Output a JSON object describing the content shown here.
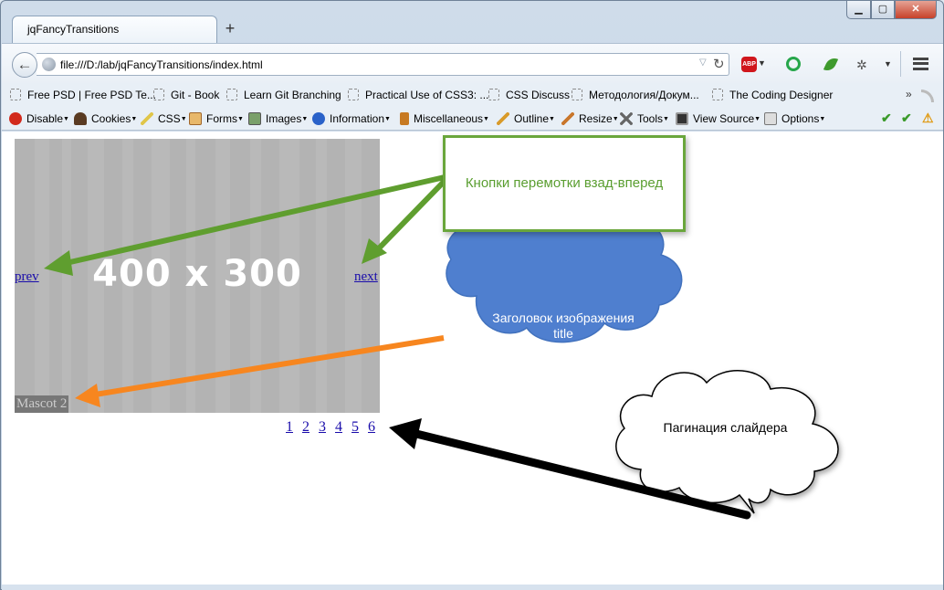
{
  "window": {
    "tab_title": "jqFancyTransitions",
    "new_tab": "+",
    "minimize": "▁",
    "maximize": "▢",
    "close": "✕"
  },
  "navbar": {
    "back": "←",
    "url": "file:///D:/lab/jqFancyTransitions/index.html",
    "abp_label": "ABP"
  },
  "bookmarks": [
    "Free PSD | Free PSD Te...",
    "Git - Book",
    "Learn Git Branching",
    "Practical Use of CSS3: ...",
    "CSS Discuss",
    "Методология/Докум...",
    "The Coding Designer"
  ],
  "bookmarks_more": "»",
  "devbar": [
    {
      "label": "Disable",
      "icon": "disable-icon",
      "color": "#d22a1c"
    },
    {
      "label": "Cookies",
      "icon": "cookies-icon",
      "color": "#5a3b22"
    },
    {
      "label": "CSS",
      "icon": "css-icon",
      "color": "#8a6b1e"
    },
    {
      "label": "Forms",
      "icon": "forms-icon",
      "color": "#b9782a"
    },
    {
      "label": "Images",
      "icon": "images-icon",
      "color": "#6b8f5a"
    },
    {
      "label": "Information",
      "icon": "information-icon",
      "color": "#2a62c9"
    },
    {
      "label": "Miscellaneous",
      "icon": "miscellaneous-icon",
      "color": "#c77a22"
    },
    {
      "label": "Outline",
      "icon": "outline-icon",
      "color": "#d99b2b"
    },
    {
      "label": "Resize",
      "icon": "resize-icon",
      "color": "#c9772c"
    },
    {
      "label": "Tools",
      "icon": "tools-icon",
      "color": "#666666"
    },
    {
      "label": "View Source",
      "icon": "view-source-icon",
      "color": "#333333"
    },
    {
      "label": "Options",
      "icon": "options-icon",
      "color": "#777777"
    }
  ],
  "slider": {
    "image_label": "400 x 300",
    "prev": "prev",
    "next": "next",
    "caption": "Mascot 2",
    "pages": [
      "1",
      "2",
      "3",
      "4",
      "5",
      "6"
    ]
  },
  "annotations": {
    "nav_buttons": "Кнопки перемотки взад-вперед",
    "title_line1": "Заголовок изображения",
    "title_line2": "title",
    "pagination": "Пагинация слайдера"
  },
  "colors": {
    "green": "#5f9e2f",
    "orange": "#f7861f",
    "blue_cloud": "#4f7fcf",
    "black_arrow": "#000000"
  }
}
